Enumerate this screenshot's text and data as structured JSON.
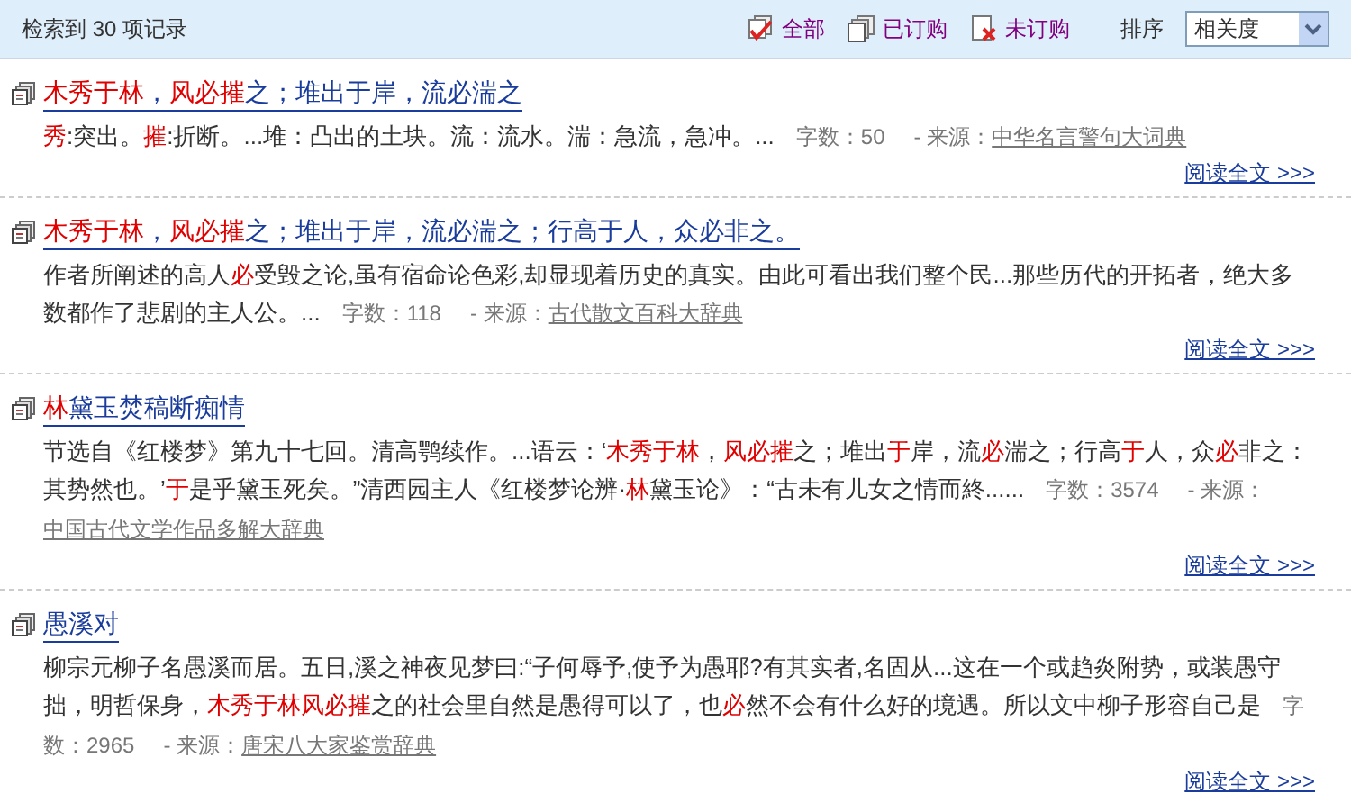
{
  "header": {
    "result_count": "检索到 30 项记录",
    "filters": [
      {
        "label": "全部",
        "kind": "all"
      },
      {
        "label": "已订购",
        "kind": "bought"
      },
      {
        "label": "未订购",
        "kind": "unbought"
      }
    ],
    "sort_label": "排序",
    "sort_value": "相关度"
  },
  "records": [
    {
      "title": "**木秀于林**，**风必摧**之；堆出于岸，流必湍之",
      "snippet": "**秀**:突出。**摧**:折断。...堆：凸出的土块。流：流水。湍：急流，急冲。...",
      "count": "字数：50",
      "source_label": "- 来源：",
      "source": "中华名言警句大词典",
      "read_more": "阅读全文 >>>"
    },
    {
      "title": "**木秀于林**，**风必摧**之；堆出于岸，流必湍之；行高于人，众必非之。",
      "snippet": "作者所阐述的高人**必**受毁之论,虽有宿命论色彩,却显现着历史的真实。由此可看出我们整个民...那些历代的开拓者，绝大多数都作了悲剧的主人公。...",
      "count": "字数：118",
      "source_label": "- 来源：",
      "source": "古代散文百科大辞典",
      "read_more": "阅读全文 >>>"
    },
    {
      "title": "**林**黛玉焚稿断痴情",
      "snippet": "节选自《红楼梦》第九十七回。清高鹗续作。...语云：‘**木秀于林**，**风必摧**之；堆出**于**岸，流**必**湍之；行高**于**人，众**必**非之：其势然也。’**于**是乎黛玉死矣。”清西园主人《红楼梦论辨·**林**黛玉论》：“古未有儿女之情而終......",
      "count": "字数：3574",
      "source_label": "- 来源：",
      "source": "中国古代文学作品多解大辞典",
      "read_more": "阅读全文 >>>"
    },
    {
      "title": "愚溪对",
      "snippet": "柳宗元柳子名愚溪而居。五日,溪之神夜见梦曰:“子何辱予,使予为愚耶?有其实者,名固从...这在一个或趋炎附势，或装愚守拙，明哲保身，**木秀于林风必摧**之的社会里自然是愚得可以了，也**必**然不会有什么好的境遇。所以文中柳子形容自己是",
      "count": "字数：2965",
      "source_label": "- 来源：",
      "source": "唐宋八大家鉴赏辞典",
      "read_more": "阅读全文 >>>"
    }
  ]
}
